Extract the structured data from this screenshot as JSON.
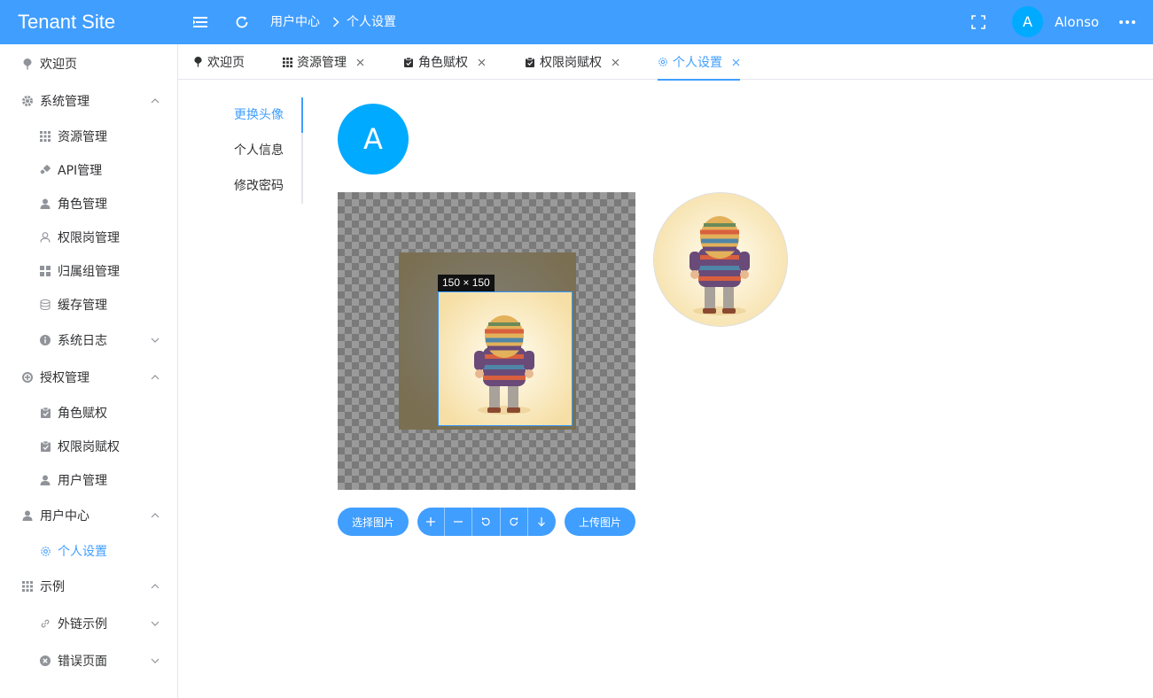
{
  "header": {
    "logo": "Tenant Site",
    "breadcrumb": [
      "用户中心",
      "个人设置"
    ],
    "user_initial": "A",
    "username": "Alonso",
    "accent": "#409eff"
  },
  "sidebar": {
    "items": [
      {
        "label": "欢迎页",
        "icon": "pin-icon"
      },
      {
        "label": "系统管理",
        "icon": "gear-icon",
        "expanded": true
      },
      {
        "label": "资源管理",
        "icon": "grid-icon"
      },
      {
        "label": "API管理",
        "icon": "plug-icon"
      },
      {
        "label": "角色管理",
        "icon": "user-icon"
      },
      {
        "label": "权限岗管理",
        "icon": "user-outline-icon"
      },
      {
        "label": "归属组管理",
        "icon": "apps-icon"
      },
      {
        "label": "缓存管理",
        "icon": "database-icon"
      },
      {
        "label": "系统日志",
        "icon": "info-icon",
        "expanded": false
      },
      {
        "label": "授权管理",
        "icon": "plus-circle-icon",
        "expanded": true
      },
      {
        "label": "角色赋权",
        "icon": "clipboard-check-icon"
      },
      {
        "label": "权限岗赋权",
        "icon": "clipboard-check-icon"
      },
      {
        "label": "用户管理",
        "icon": "user-icon"
      },
      {
        "label": "用户中心",
        "icon": "user-icon",
        "expanded": true
      },
      {
        "label": "个人设置",
        "icon": "gear-outline-icon",
        "active": true
      },
      {
        "label": "示例",
        "icon": "grid-icon",
        "expanded": true
      },
      {
        "label": "外链示例",
        "icon": "link-icon",
        "expanded": false
      },
      {
        "label": "错误页面",
        "icon": "close-circle-icon",
        "expanded": false
      }
    ]
  },
  "tabs": [
    {
      "label": "欢迎页",
      "icon": "pin-icon",
      "closable": false
    },
    {
      "label": "资源管理",
      "icon": "grid-icon",
      "closable": true
    },
    {
      "label": "角色赋权",
      "icon": "clipboard-check-icon",
      "closable": true
    },
    {
      "label": "权限岗赋权",
      "icon": "clipboard-check-icon",
      "closable": true
    },
    {
      "label": "个人设置",
      "icon": "gear-outline-icon",
      "closable": true,
      "active": true
    }
  ],
  "settings_nav": [
    "更换头像",
    "个人信息",
    "修改密码"
  ],
  "avatar": {
    "initial": "A",
    "crop_size": "150 × 150"
  },
  "buttons": {
    "select_image": "选择图片",
    "upload_image": "上传图片"
  }
}
